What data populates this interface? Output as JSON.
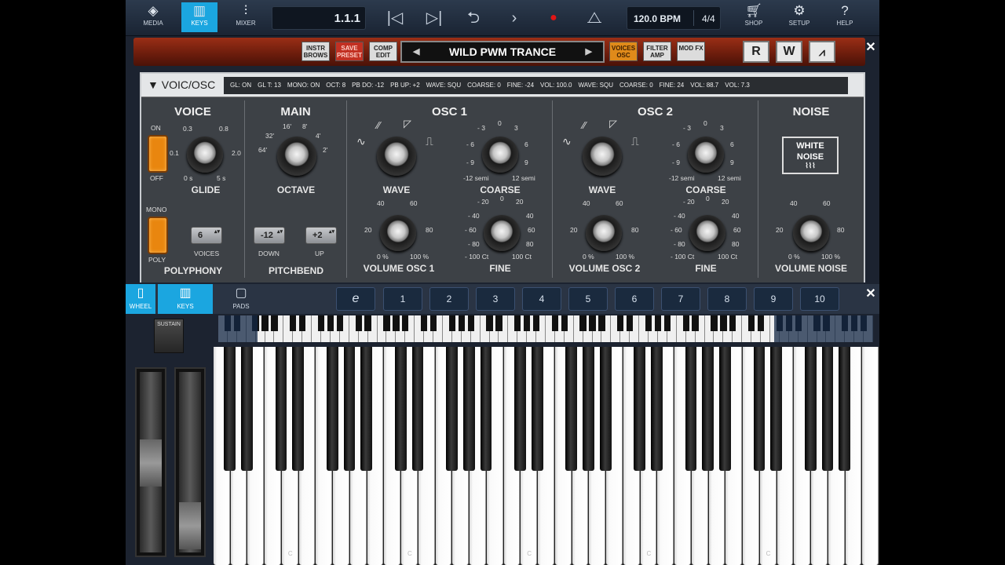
{
  "toolbar": {
    "media": "MEDIA",
    "keys": "KEYS",
    "mixer": "MIXER",
    "position": "1.1.1",
    "tempo": "120.0 BPM",
    "timesig": "4/4",
    "shop": "SHOP",
    "setup": "SETUP",
    "help": "HELP"
  },
  "header": {
    "instr_brows": "INSTR BROWS",
    "save_preset": "SAVE PRESET",
    "comp_edit": "COMP EDIT",
    "preset_name": "WILD PWM TRANCE",
    "voices_osc": "VOICES OSC",
    "filter_amp": "FILTER AMP",
    "mod_fx": "MOD FX",
    "r": "R",
    "w": "W"
  },
  "panel": {
    "title": "VOIC/OSC",
    "status": [
      "GL: ON",
      "GL T: 13",
      "MONO: ON",
      "OCT: 8",
      "PB DO: -12",
      "PB UP: +2",
      "WAVE: SQU",
      "COARSE: 0",
      "FINE: -24",
      "VOL: 100.0",
      "WAVE: SQU",
      "COARSE: 0",
      "FINE: 24",
      "VOL: 88.7",
      "VOL: 7.3"
    ],
    "voice": {
      "title": "VOICE",
      "on": "ON",
      "off": "OFF",
      "glide": "GLIDE",
      "g03": "0.3",
      "g08": "0.8",
      "g01": "0.1",
      "g20": "2.0",
      "g0s": "0 s",
      "g5s": "5 s",
      "mono": "MONO",
      "poly": "POLY",
      "voices_value": "6",
      "voices": "VOICES",
      "polyphony": "POLYPHONY"
    },
    "main": {
      "title": "MAIN",
      "octave": "OCTAVE",
      "o16": "16'",
      "o8": "8'",
      "o32": "32'",
      "o4": "4'",
      "o64": "64'",
      "o2": "2'",
      "down_value": "-12",
      "up_value": "+2",
      "down": "DOWN",
      "up": "UP",
      "pitchbend": "PITCHBEND"
    },
    "osc1": {
      "title": "OSC 1",
      "wave": "WAVE",
      "coarse": "COARSE",
      "vol_label": "VOLUME OSC 1",
      "fine": "FINE"
    },
    "osc2": {
      "title": "OSC 2",
      "wave": "WAVE",
      "coarse": "COARSE",
      "vol_label": "VOLUME OSC 2",
      "fine": "FINE"
    },
    "scales": {
      "c0": "0",
      "cm3": "- 3",
      "c3": "3",
      "cm6": "- 6",
      "c6": "6",
      "cm9": "- 9",
      "c9": "9",
      "cl": "-12 semi",
      "cr": "12 semi",
      "v40": "40",
      "v60": "60",
      "v20": "20",
      "v80": "80",
      "v0": "0 %",
      "v100": "100 %",
      "fm20": "- 20",
      "f0": "0",
      "f20": "20",
      "fm40": "- 40",
      "f40": "40",
      "fm60": "- 60",
      "f60": "60",
      "fm80": "- 80",
      "f80": "80",
      "fl": "- 100 Ct",
      "fr": "100 Ct"
    },
    "noise": {
      "title": "NOISE",
      "white": "WHITE",
      "noise": "NOISE",
      "vol_label": "VOLUME NOISE"
    }
  },
  "kbar": {
    "wheel": "WHEEL",
    "keys": "KEYS",
    "pads": "PADS",
    "octaves": [
      "1",
      "2",
      "3",
      "4",
      "5",
      "6",
      "7",
      "8",
      "9",
      "10"
    ]
  },
  "sustain": "SUSTAIN",
  "key_labels": [
    "C",
    "C",
    "C",
    "C",
    "C"
  ],
  "colors": {
    "accent": "#1ba6e0",
    "toggle": "#e9860f",
    "record": "#e01515"
  }
}
